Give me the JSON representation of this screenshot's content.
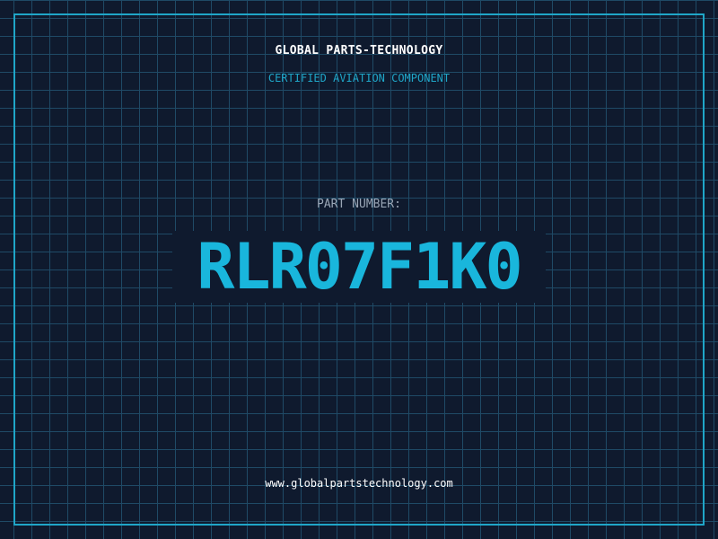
{
  "header": {
    "company": "GLOBAL PARTS-TECHNOLOGY",
    "subtitle": "CERTIFIED AVIATION COMPONENT"
  },
  "part": {
    "label": "PART NUMBER:",
    "number": "RLR07F1K0"
  },
  "footer": {
    "url": "www.globalpartstechnology.com"
  },
  "colors": {
    "background": "#0f1a2e",
    "grid": "#1f4a66",
    "accent": "#1fa6c8",
    "part_number": "#19b6dc"
  }
}
